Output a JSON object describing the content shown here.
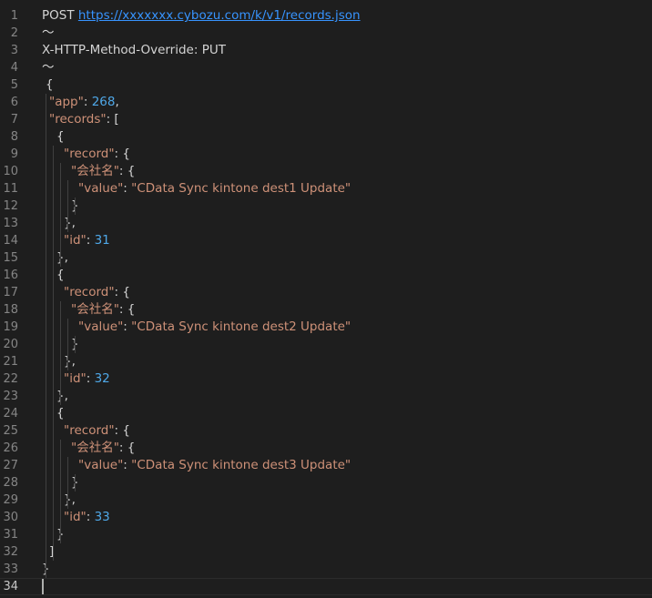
{
  "editor": {
    "lines": [
      {
        "num": "1",
        "tokens": [
          {
            "t": "plain",
            "v": "POST "
          },
          {
            "t": "link",
            "v": "https://xxxxxxx.cybozu.com/k/v1/records.json"
          }
        ]
      },
      {
        "num": "2",
        "tokens": [
          {
            "t": "plain",
            "v": "〜"
          }
        ]
      },
      {
        "num": "3",
        "tokens": [
          {
            "t": "plain",
            "v": "X-HTTP-Method-Override: PUT"
          }
        ]
      },
      {
        "num": "4",
        "tokens": [
          {
            "t": "plain",
            "v": "〜"
          }
        ]
      },
      {
        "num": "5",
        "tokens": [
          {
            "t": "punct",
            "v": "{"
          }
        ]
      },
      {
        "num": "6",
        "tokens": [
          {
            "t": "prop",
            "v": "\"app\""
          },
          {
            "t": "punct",
            "v": ": "
          },
          {
            "t": "numblue",
            "v": "268"
          },
          {
            "t": "punct",
            "v": ","
          }
        ]
      },
      {
        "num": "7",
        "tokens": [
          {
            "t": "prop",
            "v": "\"records\""
          },
          {
            "t": "punct",
            "v": ": ["
          }
        ]
      },
      {
        "num": "8",
        "tokens": [
          {
            "t": "punct",
            "v": "{"
          }
        ]
      },
      {
        "num": "9",
        "tokens": [
          {
            "t": "prop",
            "v": "\"record\""
          },
          {
            "t": "punct",
            "v": ": {"
          }
        ]
      },
      {
        "num": "10",
        "tokens": [
          {
            "t": "prop",
            "v": "\"会社名\""
          },
          {
            "t": "punct",
            "v": ": {"
          }
        ]
      },
      {
        "num": "11",
        "tokens": [
          {
            "t": "prop",
            "v": "\"value\""
          },
          {
            "t": "punct",
            "v": ": "
          },
          {
            "t": "str",
            "v": "\"CData Sync kintone dest1 Update\""
          }
        ]
      },
      {
        "num": "12",
        "tokens": [
          {
            "t": "punct",
            "v": "}"
          }
        ]
      },
      {
        "num": "13",
        "tokens": [
          {
            "t": "punct",
            "v": "},"
          }
        ]
      },
      {
        "num": "14",
        "tokens": [
          {
            "t": "prop",
            "v": "\"id\""
          },
          {
            "t": "punct",
            "v": ": "
          },
          {
            "t": "numblue",
            "v": "31"
          }
        ]
      },
      {
        "num": "15",
        "tokens": [
          {
            "t": "punct",
            "v": "},"
          }
        ]
      },
      {
        "num": "16",
        "tokens": [
          {
            "t": "punct",
            "v": "{"
          }
        ]
      },
      {
        "num": "17",
        "tokens": [
          {
            "t": "prop",
            "v": "\"record\""
          },
          {
            "t": "punct",
            "v": ": {"
          }
        ]
      },
      {
        "num": "18",
        "tokens": [
          {
            "t": "prop",
            "v": "\"会社名\""
          },
          {
            "t": "punct",
            "v": ": {"
          }
        ]
      },
      {
        "num": "19",
        "tokens": [
          {
            "t": "prop",
            "v": "\"value\""
          },
          {
            "t": "punct",
            "v": ": "
          },
          {
            "t": "str",
            "v": "\"CData Sync kintone dest2 Update\""
          }
        ]
      },
      {
        "num": "20",
        "tokens": [
          {
            "t": "punct",
            "v": "}"
          }
        ]
      },
      {
        "num": "21",
        "tokens": [
          {
            "t": "punct",
            "v": "},"
          }
        ]
      },
      {
        "num": "22",
        "tokens": [
          {
            "t": "prop",
            "v": "\"id\""
          },
          {
            "t": "punct",
            "v": ": "
          },
          {
            "t": "numblue",
            "v": "32"
          }
        ]
      },
      {
        "num": "23",
        "tokens": [
          {
            "t": "punct",
            "v": "},"
          }
        ]
      },
      {
        "num": "24",
        "tokens": [
          {
            "t": "punct",
            "v": "{"
          }
        ]
      },
      {
        "num": "25",
        "tokens": [
          {
            "t": "prop",
            "v": "\"record\""
          },
          {
            "t": "punct",
            "v": ": {"
          }
        ]
      },
      {
        "num": "26",
        "tokens": [
          {
            "t": "prop",
            "v": "\"会社名\""
          },
          {
            "t": "punct",
            "v": ": {"
          }
        ]
      },
      {
        "num": "27",
        "tokens": [
          {
            "t": "prop",
            "v": "\"value\""
          },
          {
            "t": "punct",
            "v": ": "
          },
          {
            "t": "str",
            "v": "\"CData Sync kintone dest3 Update\""
          }
        ]
      },
      {
        "num": "28",
        "tokens": [
          {
            "t": "punct",
            "v": "}"
          }
        ]
      },
      {
        "num": "29",
        "tokens": [
          {
            "t": "punct",
            "v": "},"
          }
        ]
      },
      {
        "num": "30",
        "tokens": [
          {
            "t": "prop",
            "v": "\"id\""
          },
          {
            "t": "punct",
            "v": ": "
          },
          {
            "t": "numblue",
            "v": "33"
          }
        ]
      },
      {
        "num": "31",
        "tokens": [
          {
            "t": "punct",
            "v": "}"
          }
        ]
      },
      {
        "num": "32",
        "tokens": [
          {
            "t": "punct",
            "v": "]"
          }
        ]
      },
      {
        "num": "33",
        "tokens": [
          {
            "t": "punct",
            "v": "}"
          }
        ]
      },
      {
        "num": "34",
        "tokens": []
      }
    ],
    "active_line": "34",
    "colors": {
      "background": "#1e1e1e",
      "line_number": "#858585",
      "string_key": "#ce9178",
      "string_value": "#ce9178",
      "number": "#4fa8e8",
      "link": "#3794ff"
    }
  }
}
